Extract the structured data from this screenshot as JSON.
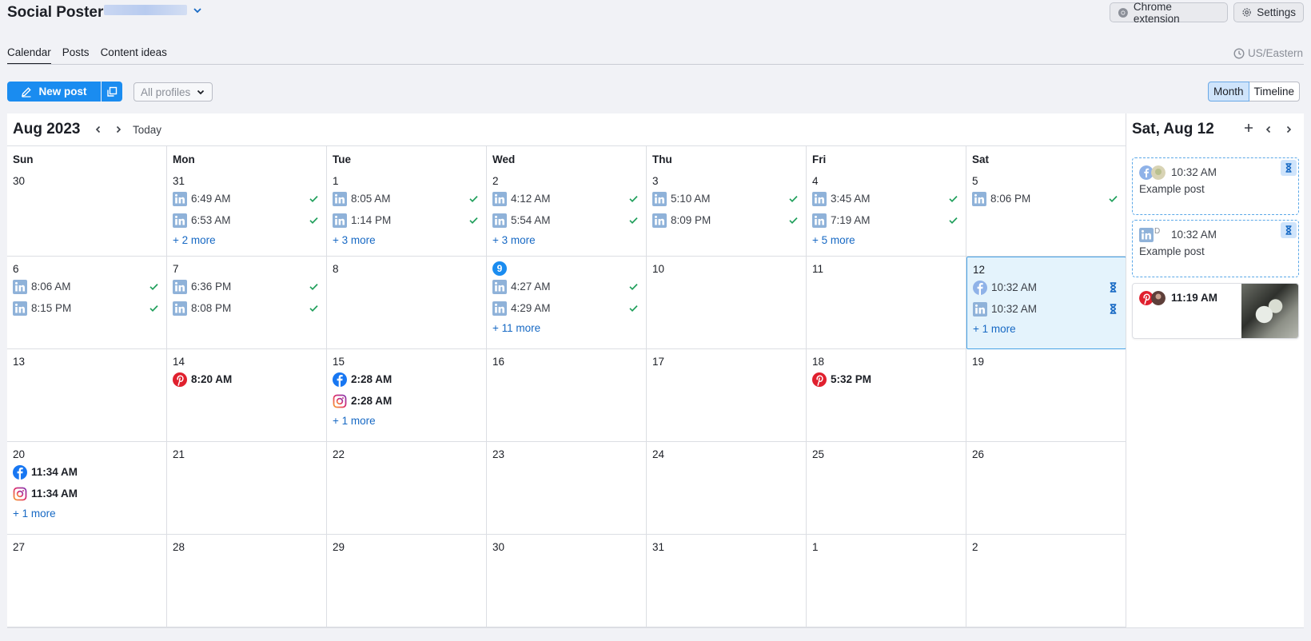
{
  "header": {
    "title": "Social Poster",
    "chrome_extension": "Chrome extension",
    "settings": "Settings"
  },
  "tabs": [
    {
      "label": "Calendar",
      "active": true
    },
    {
      "label": "Posts",
      "active": false
    },
    {
      "label": "Content ideas",
      "active": false
    }
  ],
  "timezone": "US/Eastern",
  "toolbar": {
    "new_post": "New post",
    "profiles": "All profiles",
    "view_month": "Month",
    "view_timeline": "Timeline"
  },
  "calendar": {
    "title": "Aug 2023",
    "today_label": "Today",
    "weekdays": [
      "Sun",
      "Mon",
      "Tue",
      "Wed",
      "Thu",
      "Fri",
      "Sat"
    ],
    "weeks": [
      [
        {
          "day": "30",
          "events": []
        },
        {
          "day": "31",
          "events": [
            {
              "net": "linkedin",
              "time": "6:49 AM",
              "status": "check"
            },
            {
              "net": "linkedin",
              "time": "6:53 AM",
              "status": "check"
            }
          ],
          "more": "+ 2 more"
        },
        {
          "day": "1",
          "events": [
            {
              "net": "linkedin",
              "time": "8:05 AM",
              "status": "check"
            },
            {
              "net": "linkedin",
              "time": "1:14 PM",
              "status": "check"
            }
          ],
          "more": "+ 3 more"
        },
        {
          "day": "2",
          "events": [
            {
              "net": "linkedin",
              "time": "4:12 AM",
              "status": "check"
            },
            {
              "net": "linkedin",
              "time": "5:54 AM",
              "status": "check"
            }
          ],
          "more": "+ 3 more"
        },
        {
          "day": "3",
          "events": [
            {
              "net": "linkedin",
              "time": "5:10 AM",
              "status": "check"
            },
            {
              "net": "linkedin",
              "time": "8:09 PM",
              "status": "check"
            }
          ]
        },
        {
          "day": "4",
          "events": [
            {
              "net": "linkedin",
              "time": "3:45 AM",
              "status": "check"
            },
            {
              "net": "linkedin",
              "time": "7:19 AM",
              "status": "check"
            }
          ],
          "more": "+ 5 more"
        },
        {
          "day": "5",
          "events": [
            {
              "net": "linkedin",
              "time": "8:06 PM",
              "status": "check"
            }
          ]
        }
      ],
      [
        {
          "day": "6",
          "events": [
            {
              "net": "linkedin",
              "time": "8:06 AM",
              "status": "check"
            },
            {
              "net": "linkedin",
              "time": "8:15 PM",
              "status": "check"
            }
          ]
        },
        {
          "day": "7",
          "events": [
            {
              "net": "linkedin",
              "time": "6:36 PM",
              "status": "check"
            },
            {
              "net": "linkedin",
              "time": "8:08 PM",
              "status": "check"
            }
          ]
        },
        {
          "day": "8",
          "events": []
        },
        {
          "day": "9",
          "today": true,
          "events": [
            {
              "net": "linkedin",
              "time": "4:27 AM",
              "status": "check"
            },
            {
              "net": "linkedin",
              "time": "4:29 AM",
              "status": "check"
            }
          ],
          "more": "+ 11 more"
        },
        {
          "day": "10",
          "events": []
        },
        {
          "day": "11",
          "events": []
        },
        {
          "day": "12",
          "selected": true,
          "events": [
            {
              "net": "facebook-light",
              "time": "10:32 AM",
              "status": "hourglass"
            },
            {
              "net": "linkedin",
              "time": "10:32 AM",
              "status": "hourglass"
            }
          ],
          "more": "+ 1 more"
        }
      ],
      [
        {
          "day": "13",
          "events": []
        },
        {
          "day": "14",
          "events": [
            {
              "net": "pinterest",
              "time": "8:20 AM",
              "bold": true
            }
          ]
        },
        {
          "day": "15",
          "events": [
            {
              "net": "facebook",
              "time": "2:28 AM",
              "bold": true
            },
            {
              "net": "instagram",
              "time": "2:28 AM",
              "bold": true
            }
          ],
          "more": "+ 1 more"
        },
        {
          "day": "16",
          "events": []
        },
        {
          "day": "17",
          "events": []
        },
        {
          "day": "18",
          "events": [
            {
              "net": "pinterest",
              "time": "5:32 PM",
              "bold": true
            }
          ]
        },
        {
          "day": "19",
          "events": []
        }
      ],
      [
        {
          "day": "20",
          "events": [
            {
              "net": "facebook",
              "time": "11:34 AM",
              "bold": true
            },
            {
              "net": "instagram",
              "time": "11:34 AM",
              "bold": true
            }
          ],
          "more": "+ 1 more"
        },
        {
          "day": "21",
          "events": []
        },
        {
          "day": "22",
          "events": []
        },
        {
          "day": "23",
          "events": []
        },
        {
          "day": "24",
          "events": []
        },
        {
          "day": "25",
          "events": []
        },
        {
          "day": "26",
          "events": []
        }
      ],
      [
        {
          "day": "27",
          "events": []
        },
        {
          "day": "28",
          "events": []
        },
        {
          "day": "29",
          "events": []
        },
        {
          "day": "30",
          "events": []
        },
        {
          "day": "31",
          "events": []
        },
        {
          "day": "1",
          "events": []
        },
        {
          "day": "2",
          "events": []
        }
      ]
    ]
  },
  "side": {
    "title": "Sat, Aug 12",
    "cards": [
      {
        "time": "10:32 AM",
        "text": "Example post",
        "nets": [
          "facebook-light",
          "avatar"
        ],
        "status": "hourglass"
      },
      {
        "time": "10:32 AM",
        "text": "Example post",
        "nets": [
          "linkedin",
          "letter-d"
        ],
        "status": "hourglass"
      },
      {
        "time": "11:19 AM",
        "text": "",
        "nets": [
          "pinterest",
          "avatar-dark"
        ],
        "image": true
      }
    ]
  },
  "colors": {
    "accent": "#1a8cf0",
    "linkedin": "#8fb2d9",
    "check": "#1e9e5a",
    "pinterest": "#e0202e",
    "facebook": "#1877f2"
  }
}
